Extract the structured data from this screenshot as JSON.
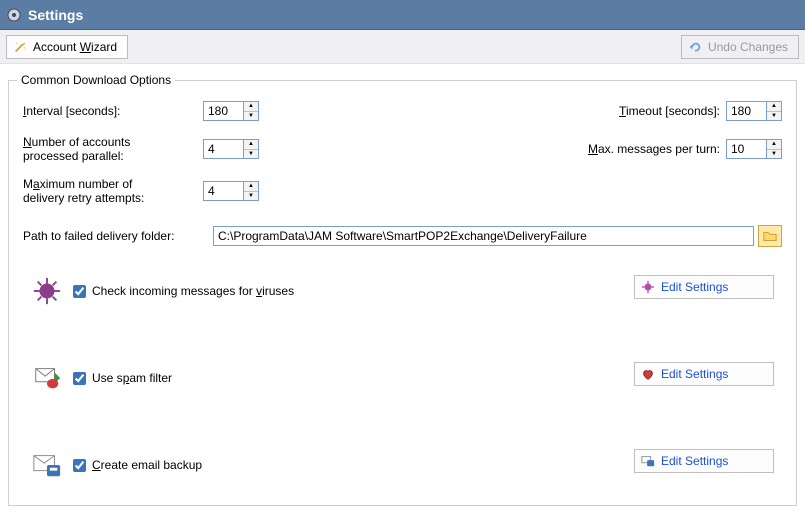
{
  "title": "Settings",
  "toolbar": {
    "account_wizard": "Account Wizard",
    "undo_changes": "Undo Changes"
  },
  "fieldset": {
    "legend": "Common Download Options",
    "interval_label": "Interval [seconds]:",
    "interval_value": "180",
    "number_accounts_label": "Number of accounts processed parallel:",
    "number_accounts_value": "4",
    "max_retry_label": "Maximum number of delivery retry attempts:",
    "max_retry_value": "4",
    "timeout_label": "Timeout [seconds]:",
    "timeout_value": "180",
    "max_messages_label": "Max. messages per turn:",
    "max_messages_value": "10",
    "path_label": "Path to failed delivery folder:",
    "path_value": "C:\\ProgramData\\JAM Software\\SmartPOP2Exchange\\DeliveryFailure"
  },
  "options": {
    "virus": {
      "label": "Check incoming messages for viruses",
      "checked": true,
      "button": "Edit Settings"
    },
    "spam": {
      "label": "Use spam filter",
      "checked": true,
      "button": "Edit Settings"
    },
    "backup": {
      "label": "Create email backup",
      "checked": true,
      "button": "Edit Settings"
    }
  }
}
